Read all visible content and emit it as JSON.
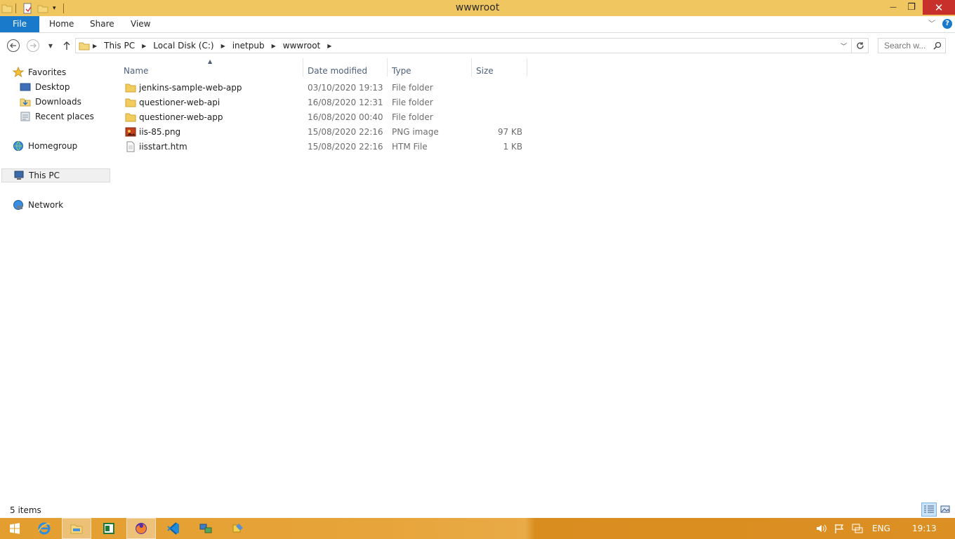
{
  "window": {
    "title": "wwwroot",
    "minimize_glyph": "—",
    "restore_glyph": "❐",
    "close_glyph": "✕"
  },
  "ribbon": {
    "tabs": [
      "File",
      "Home",
      "Share",
      "View"
    ],
    "help_glyph": "?"
  },
  "address": {
    "breadcrumbs": [
      "This PC",
      "Local Disk (C:)",
      "inetpub",
      "wwwroot"
    ],
    "search_placeholder": "Search w..."
  },
  "nav": {
    "favorites": "Favorites",
    "desktop": "Desktop",
    "downloads": "Downloads",
    "recent": "Recent places",
    "homegroup": "Homegroup",
    "thispc": "This PC",
    "network": "Network"
  },
  "columns": {
    "name": "Name",
    "date": "Date modified",
    "type": "Type",
    "size": "Size"
  },
  "files": [
    {
      "name": "jenkins-sample-web-app",
      "date": "03/10/2020 19:13",
      "type": "File folder",
      "size": "",
      "icon": "folder-icon"
    },
    {
      "name": "questioner-web-api",
      "date": "16/08/2020 12:31",
      "type": "File folder",
      "size": "",
      "icon": "folder-icon"
    },
    {
      "name": "questioner-web-app",
      "date": "16/08/2020 00:40",
      "type": "File folder",
      "size": "",
      "icon": "folder-icon"
    },
    {
      "name": "iis-85.png",
      "date": "15/08/2020 22:16",
      "type": "PNG image",
      "size": "97 KB",
      "icon": "image-file-icon"
    },
    {
      "name": "iisstart.htm",
      "date": "15/08/2020 22:16",
      "type": "HTM File",
      "size": "1 KB",
      "icon": "document-file-icon"
    }
  ],
  "status": {
    "count": "5 items"
  },
  "taskbar": {
    "language": "ENG",
    "time": "19:13"
  },
  "colors": {
    "titlebar": "#f0c661",
    "file_tab": "#1979ca",
    "close": "#c7302b",
    "taskbar": "#e39e2f"
  }
}
